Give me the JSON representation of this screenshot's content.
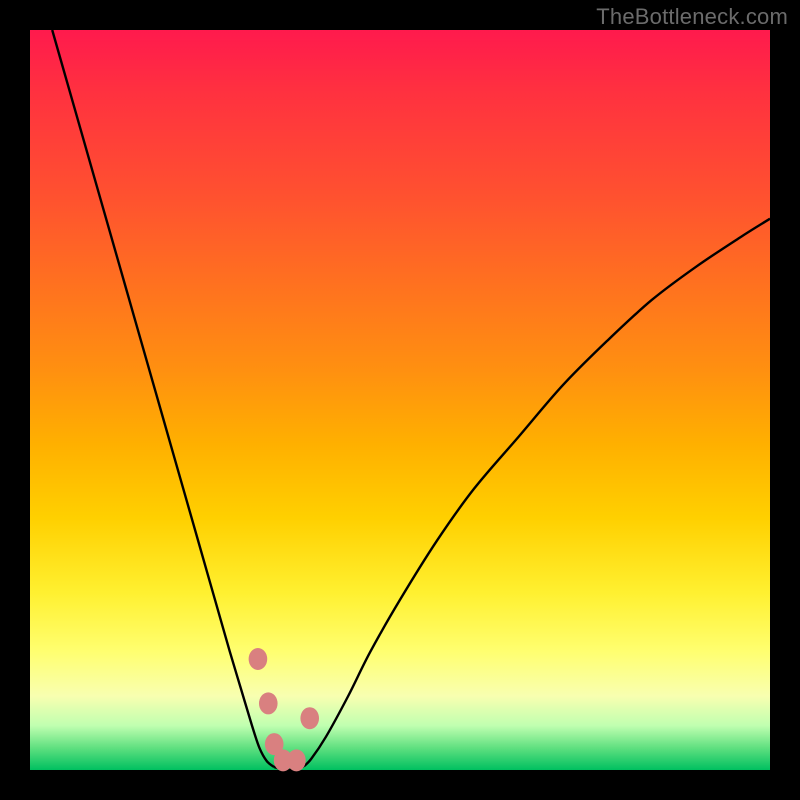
{
  "watermark": "TheBottleneck.com",
  "colors": {
    "background": "#000000",
    "curve": "#000000",
    "markers_fill": "#d98080",
    "markers_stroke": "#b24040",
    "gradient_top": "#ff1a4d",
    "gradient_bottom": "#00c060"
  },
  "chart_data": {
    "type": "line",
    "title": "",
    "xlabel": "",
    "ylabel": "",
    "xlim": [
      0,
      100
    ],
    "ylim": [
      0,
      100
    ],
    "series": [
      {
        "name": "left-branch",
        "x": [
          3,
          5,
          7,
          9,
          11,
          13,
          15,
          17,
          19,
          21,
          23,
          25,
          27,
          28.5,
          30,
          31,
          32,
          33
        ],
        "y": [
          100,
          93,
          86,
          79,
          72,
          65,
          58,
          51,
          44,
          37,
          30,
          23,
          16,
          11,
          6,
          3,
          1.2,
          0.4
        ]
      },
      {
        "name": "valley-floor",
        "x": [
          33,
          34,
          35,
          36,
          37
        ],
        "y": [
          0.4,
          0.1,
          0.0,
          0.1,
          0.5
        ]
      },
      {
        "name": "right-branch",
        "x": [
          37,
          38,
          40,
          43,
          46,
          50,
          55,
          60,
          66,
          72,
          78,
          84,
          90,
          96,
          100
        ],
        "y": [
          0.5,
          1.5,
          4.5,
          10,
          16,
          23,
          31,
          38,
          45,
          52,
          58,
          63.5,
          68,
          72,
          74.5
        ]
      }
    ],
    "markers": [
      {
        "name": "left-marker-top",
        "x": 30.8,
        "y": 85
      },
      {
        "name": "left-marker-low",
        "x": 32.2,
        "y": 91
      },
      {
        "name": "valley-marker-1",
        "x": 33.0,
        "y": 96.5
      },
      {
        "name": "valley-marker-2",
        "x": 34.2,
        "y": 98.7
      },
      {
        "name": "valley-marker-3",
        "x": 36.0,
        "y": 98.7
      },
      {
        "name": "right-marker",
        "x": 37.8,
        "y": 93
      }
    ],
    "marker_radius_px": 11,
    "marker_note": "marker.y is in screen-percent from top (inverted vs ylim)"
  }
}
